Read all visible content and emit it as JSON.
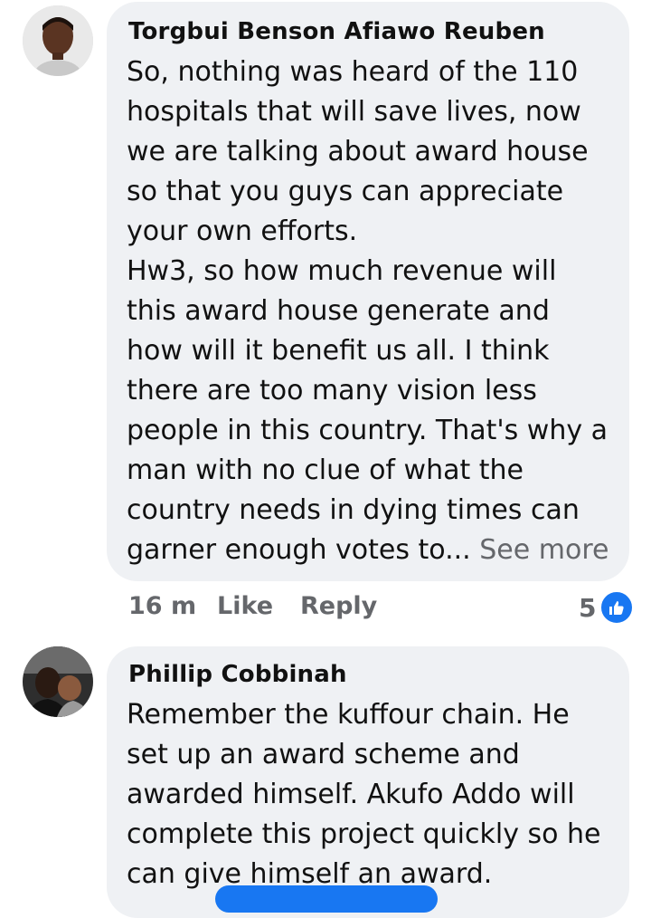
{
  "comments": [
    {
      "author": "Torgbui Benson Afiawo Reuben",
      "paragraphs": [
        "So, nothing was heard of the 110 hospitals that will save lives, now we are talking about award house so that you guys can appreciate your own efforts.",
        "Hw3, so how much revenue will this award house generate and how will it benefit us all. I think there are too many vision less people in this country. That's why a man with no clue of what the country needs in dying times can garner enough votes to..."
      ],
      "see_more": "See more",
      "time": "16 m",
      "like_label": "Like",
      "reply_label": "Reply",
      "reaction_count": "5",
      "reaction_icon": "like-icon"
    },
    {
      "author": "Phillip Cobbinah",
      "paragraphs": [
        "Remember the kuffour chain. He set up an award scheme and awarded himself. Akufo Addo will complete this project quickly so he can give himself an award."
      ]
    }
  ],
  "colors": {
    "bubble": "#eff1f4",
    "meta_text": "#65676b",
    "accent": "#1877f2"
  }
}
